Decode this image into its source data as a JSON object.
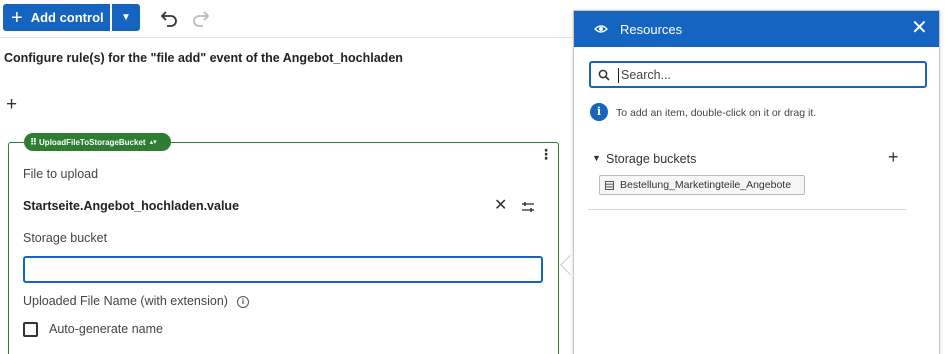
{
  "toolbar": {
    "add_control_label": "Add control",
    "add_icon": "plus-icon",
    "dropdown_icon": "caret-down-icon",
    "undo_icon": "undo-icon",
    "redo_icon": "redo-icon"
  },
  "heading": "Configure rule(s) for the \"file add\" event of the Angebot_hochladen",
  "add_rule_symbol": "+",
  "rule": {
    "name": "UploadFileToStorageBucket",
    "accent_color": "#2e7d32",
    "file_to_upload_label": "File to upload",
    "file_to_upload_value": "Startseite.Angebot_hochladen.value",
    "storage_bucket_label": "Storage bucket",
    "storage_bucket_value": "",
    "uploaded_name_label": "Uploaded File Name (with extension)",
    "auto_generate_label": "Auto-generate name",
    "auto_generate_checked": false
  },
  "resources": {
    "title": "Resources",
    "search_placeholder": "Search...",
    "hint": "To add an item, double-click on it or drag it.",
    "section_title": "Storage buckets",
    "items": [
      "Bestellung_Marketingteile_Angebote"
    ]
  },
  "colors": {
    "primary": "#1565c0",
    "rule_border": "#2e7d32"
  }
}
